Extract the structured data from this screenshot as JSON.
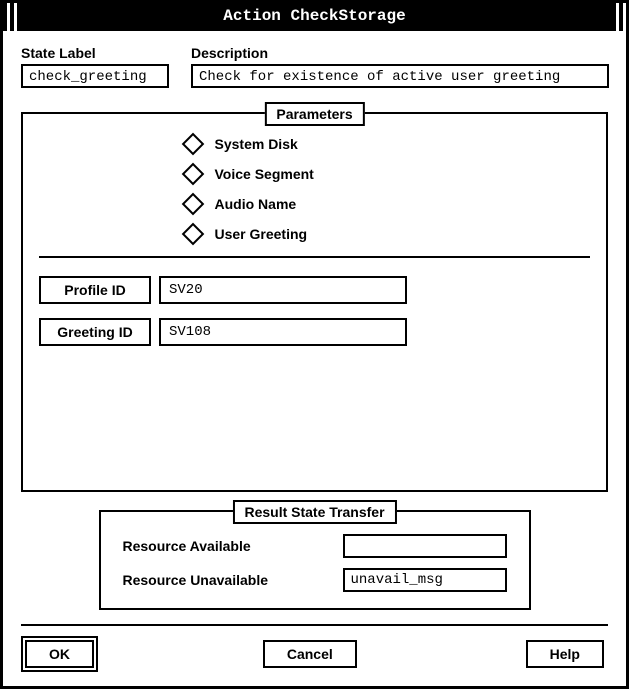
{
  "window_title": "Action CheckStorage",
  "state_label_caption": "State Label",
  "state_label_value": "check_greeting",
  "description_caption": "Description",
  "description_value": "Check for existence of active user greeting",
  "parameters": {
    "legend": "Parameters",
    "options": [
      {
        "label": "System Disk"
      },
      {
        "label": "Voice Segment"
      },
      {
        "label": "Audio Name"
      },
      {
        "label": "User Greeting"
      }
    ],
    "fields": [
      {
        "label": "Profile ID",
        "value": "SV20"
      },
      {
        "label": "Greeting ID",
        "value": "SV108"
      }
    ]
  },
  "result": {
    "legend": "Result State Transfer",
    "available_label": "Resource Available",
    "available_value": "",
    "unavailable_label": "Resource Unavailable",
    "unavailable_value": "unavail_msg"
  },
  "buttons": {
    "ok": "OK",
    "cancel": "Cancel",
    "help": "Help"
  }
}
